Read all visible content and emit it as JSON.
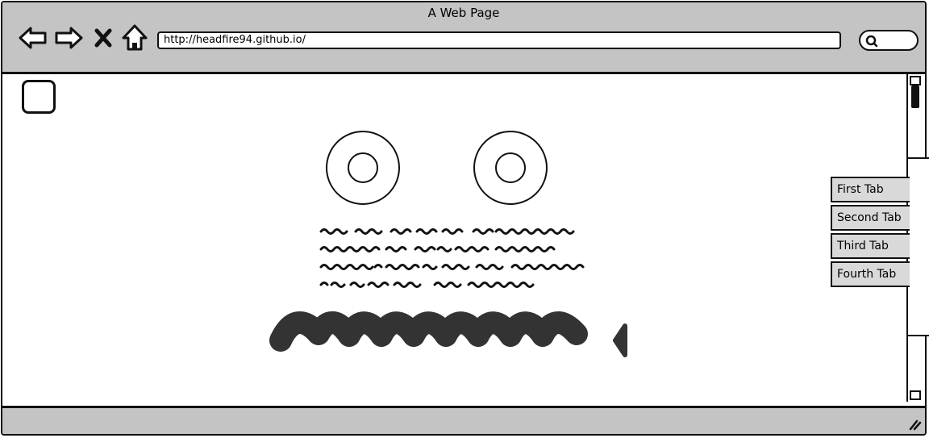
{
  "window": {
    "title": "A Web Page"
  },
  "toolbar": {
    "back_icon": "arrow-left-icon",
    "forward_icon": "arrow-right-icon",
    "stop_icon": "close-x-icon",
    "home_icon": "home-icon",
    "url": "http://headfire94.github.io/",
    "search_icon": "magnifier-icon"
  },
  "content": {
    "checkbox_checked": false,
    "tabs": [
      {
        "label": "First Tab"
      },
      {
        "label": "Second Tab"
      },
      {
        "label": "Third Tab"
      },
      {
        "label": "Fourth Tab"
      }
    ]
  },
  "colors": {
    "chrome": "#c4c4c4",
    "ink": "#111111",
    "tab": "#d9d9d9",
    "headline_scribble": "#333333"
  }
}
